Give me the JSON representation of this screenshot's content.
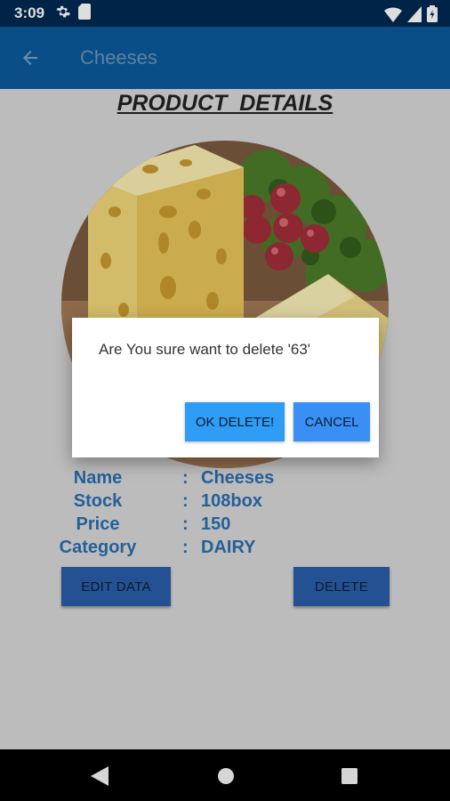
{
  "status_bar": {
    "time": "3:09",
    "icons_left": [
      "gear-icon",
      "sd-card-icon"
    ],
    "icons_right": [
      "wifi-icon",
      "signal-icon",
      "battery-icon"
    ]
  },
  "app_bar": {
    "back_icon": "arrow-back-icon",
    "title": "Cheeses"
  },
  "page": {
    "heading": "PRODUCT  DETAILS"
  },
  "product": {
    "image": "cheese-photo",
    "details": [
      {
        "label": "Name",
        "colon": ":",
        "value": "Cheeses"
      },
      {
        "label": "Stock",
        "colon": ":",
        "value": "108box"
      },
      {
        "label": "Price",
        "colon": ":",
        "value": "150"
      },
      {
        "label": "Category",
        "colon": ":",
        "value": "DAIRY"
      }
    ]
  },
  "actions": {
    "edit_label": "EDIT DATA",
    "delete_label": "DELETE"
  },
  "dialog": {
    "message": "Are You sure want to delete '63'",
    "ok_label": "OK DELETE!",
    "cancel_label": "CANCEL"
  },
  "nav_bar": {
    "icons": [
      "back-triangle-icon",
      "home-circle-icon",
      "recents-square-icon"
    ]
  },
  "colors": {
    "status_bar": "#002a52",
    "app_bar": "#0b5a9a",
    "accent": "#2a6fb0",
    "dialog_button": "#2f9cf5"
  }
}
